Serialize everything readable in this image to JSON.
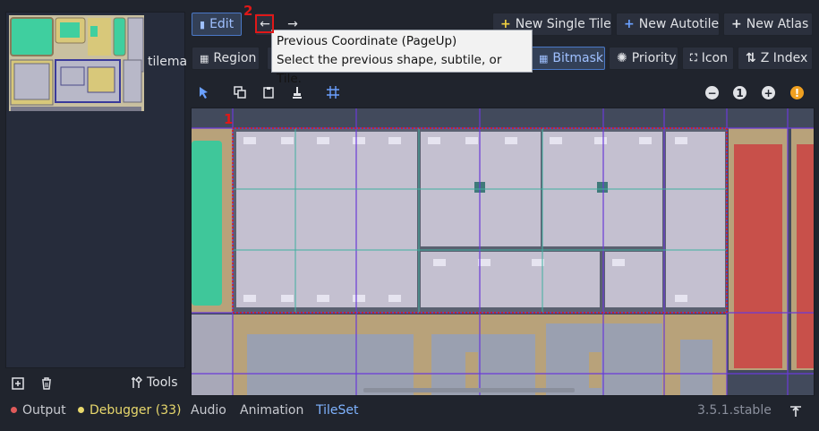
{
  "left_panel": {
    "tileset_label": "tilema",
    "add_label": "⊞",
    "delete_label": "🗑",
    "tools_label": "Tools"
  },
  "toolbar": {
    "edit_label": "Edit",
    "prev_label": "←",
    "next_label": "→",
    "new_single_tile": "New Single Tile",
    "new_autotile": "New Autotile",
    "new_atlas": "New Atlas"
  },
  "tabs": {
    "region": "Region",
    "bitmask": "Bitmask",
    "priority": "Priority",
    "icon": "Icon",
    "z_index": "Z Index"
  },
  "tooltip": {
    "line1": "Previous Coordinate (PageUp)",
    "line2": "Select the previous shape, subtile, or Tile."
  },
  "markers": {
    "one": "1",
    "two": "2"
  },
  "bottom_bar": {
    "output": "Output",
    "debugger": "Debugger (33)",
    "audio": "Audio",
    "animation": "Animation",
    "tileset": "TileSet",
    "version": "3.5.1.stable"
  },
  "colors": {
    "accent": "#4a78c6",
    "active_text": "#9fc0ff",
    "output_dot": "#e05a5a",
    "debugger_dot": "#e8d86c",
    "tileset_text": "#7fb3ff",
    "marker_red": "#e01818"
  }
}
